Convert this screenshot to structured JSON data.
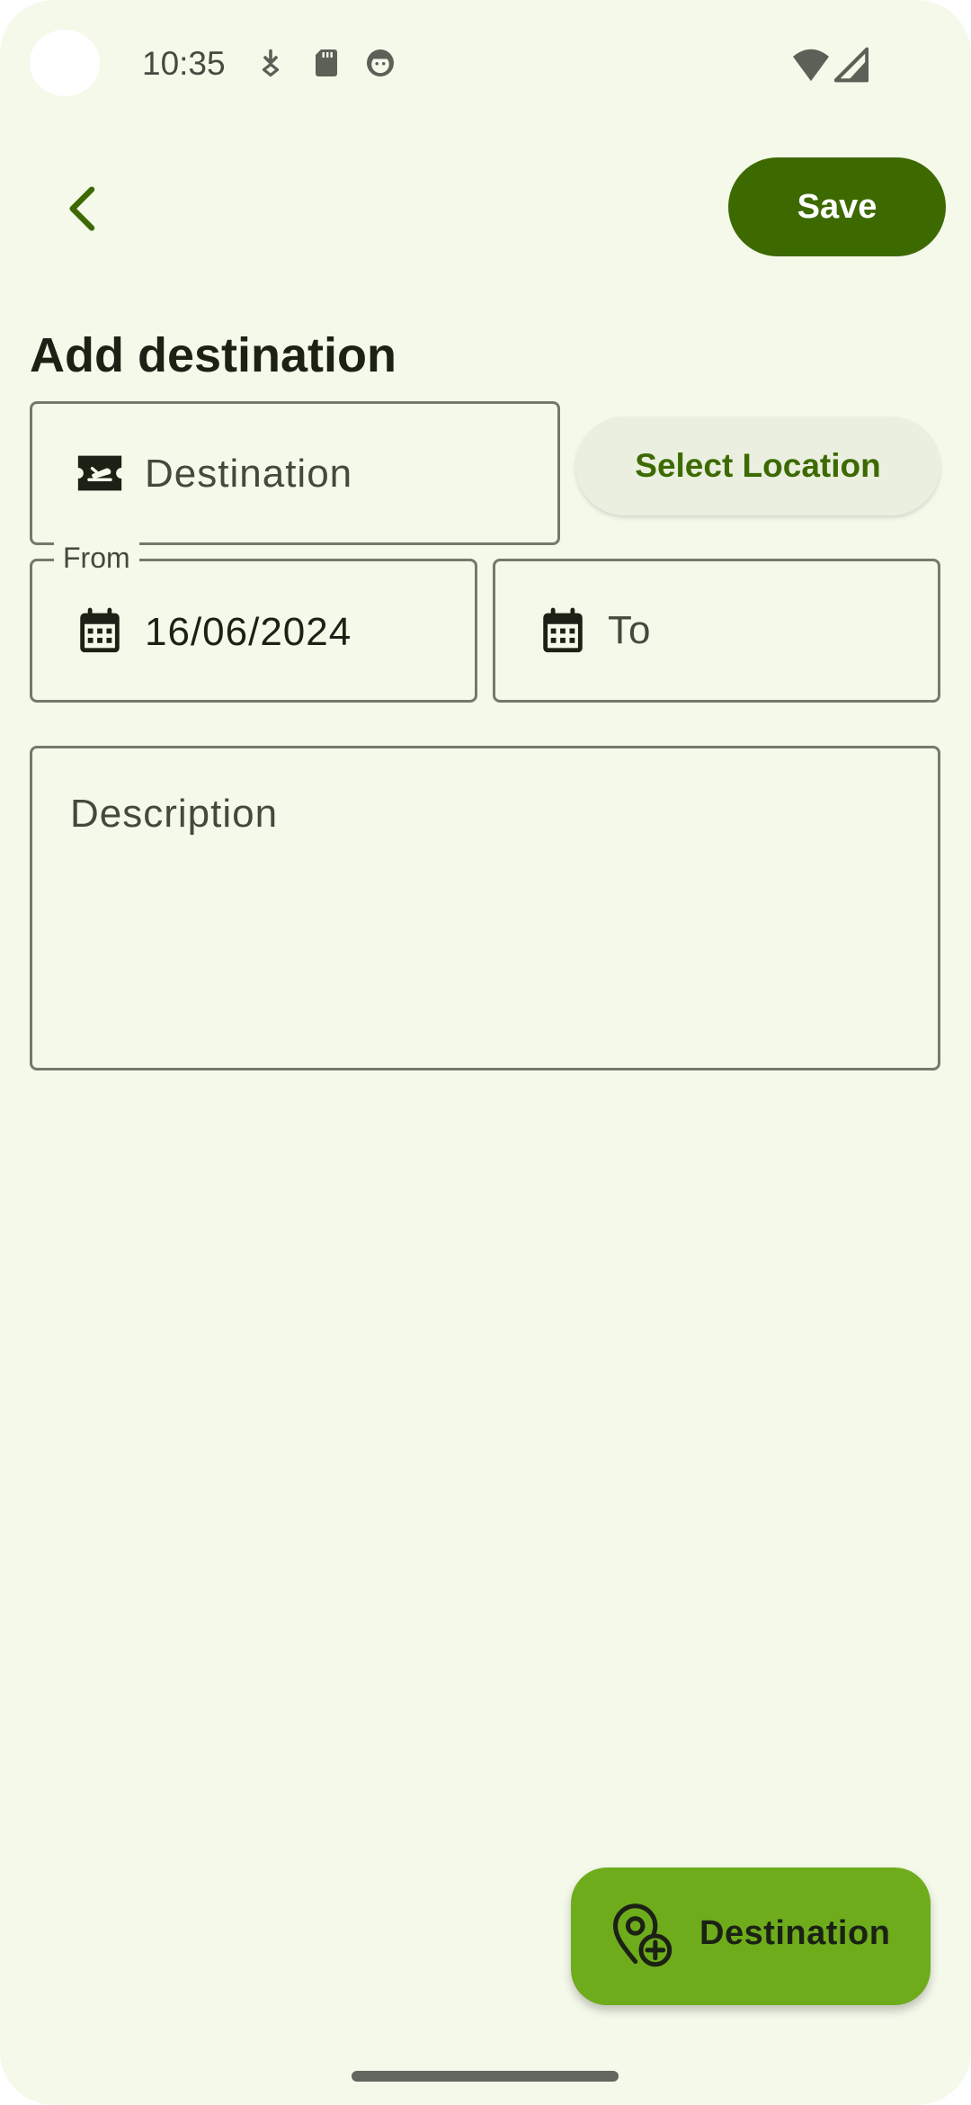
{
  "status_bar": {
    "time": "10:35",
    "icons": [
      "download-icon",
      "sd-card-icon",
      "android-head-icon"
    ],
    "right_icons": [
      "wifi-icon",
      "cell-signal-icon"
    ]
  },
  "topbar": {
    "back_icon": "chevron-left-icon",
    "save_label": "Save"
  },
  "title": "Add destination",
  "destination_field": {
    "icon": "flight-ticket-icon",
    "placeholder": "Destination"
  },
  "select_location_label": "Select Location",
  "from_field": {
    "label": "From",
    "icon": "calendar-icon",
    "value": "16/06/2024"
  },
  "to_field": {
    "icon": "calendar-icon",
    "placeholder": "To"
  },
  "description_field": {
    "placeholder": "Description"
  },
  "fab": {
    "icon": "add-location-icon",
    "label": "Destination"
  },
  "colors": {
    "background": "#f4f9ea",
    "primary": "#3d6a00",
    "fab": "#6eac1c",
    "outline": "#737a6c"
  }
}
